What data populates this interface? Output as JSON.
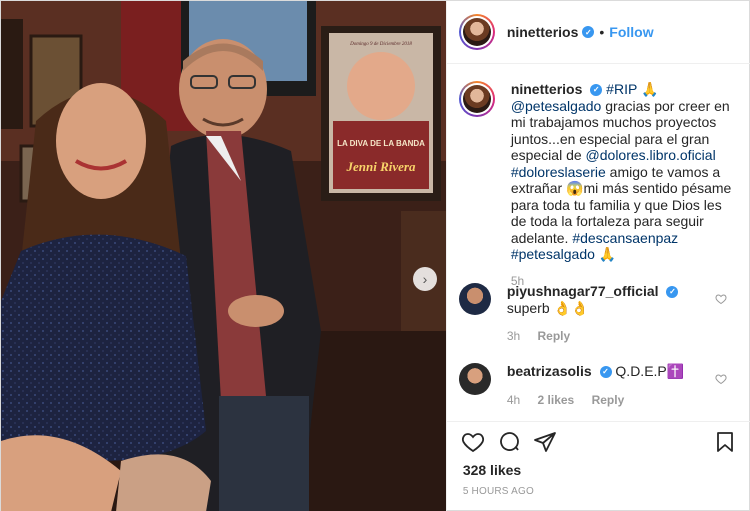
{
  "post": {
    "username": "ninetterios",
    "follow_label": "Follow",
    "separator": "•",
    "likes": "328 likes",
    "time_ago": "5 HOURS AGO",
    "caption": {
      "username": "ninetterios",
      "tag_rip": "#RIP",
      "pray_emoji": "🙏",
      "mention_pete": "@petesalgado",
      "text_1": "gracias por creer en mi trabajamos muchos proyectos juntos...en especial para el gran especial de",
      "mention_dolores": "@dolores.libro.oficial",
      "tag_serie": "#doloreslaserie",
      "text_2": "amigo te vamos a extrañar",
      "cry_emoji": "😱",
      "text_3": "mi más sentido pésame para toda tu familia y que Dios les de toda la fortaleza para seguir adelante.",
      "tag_descansa": "#descansaenpaz",
      "tag_pete": "#petesalgado",
      "pray_emoji_2": "🙏",
      "time": "5h"
    },
    "comments": [
      {
        "username": "piyushnagar77_official",
        "text": "superb 👌👌",
        "time": "3h",
        "reply_label": "Reply"
      },
      {
        "username": "beatrizasolis",
        "text": "Q.D.E.P✝️",
        "time": "4h",
        "likes": "2 likes",
        "reply_label": "Reply"
      }
    ]
  },
  "photo": {
    "poster_title": "LA DIVA DE LA BANDA",
    "poster_name": "Jenni Rivera",
    "poster_date": "Domingo 9 de Diciembre 2018"
  },
  "colors": {
    "link": "#003569",
    "follow": "#3897f0",
    "verified": "#3897f0",
    "muted": "#999999"
  },
  "icons": {
    "verified": "verified-check-icon",
    "next": "chevron-right-icon",
    "like": "heart-icon",
    "comment": "comment-bubble-icon",
    "share": "paper-plane-icon",
    "save": "bookmark-icon"
  }
}
